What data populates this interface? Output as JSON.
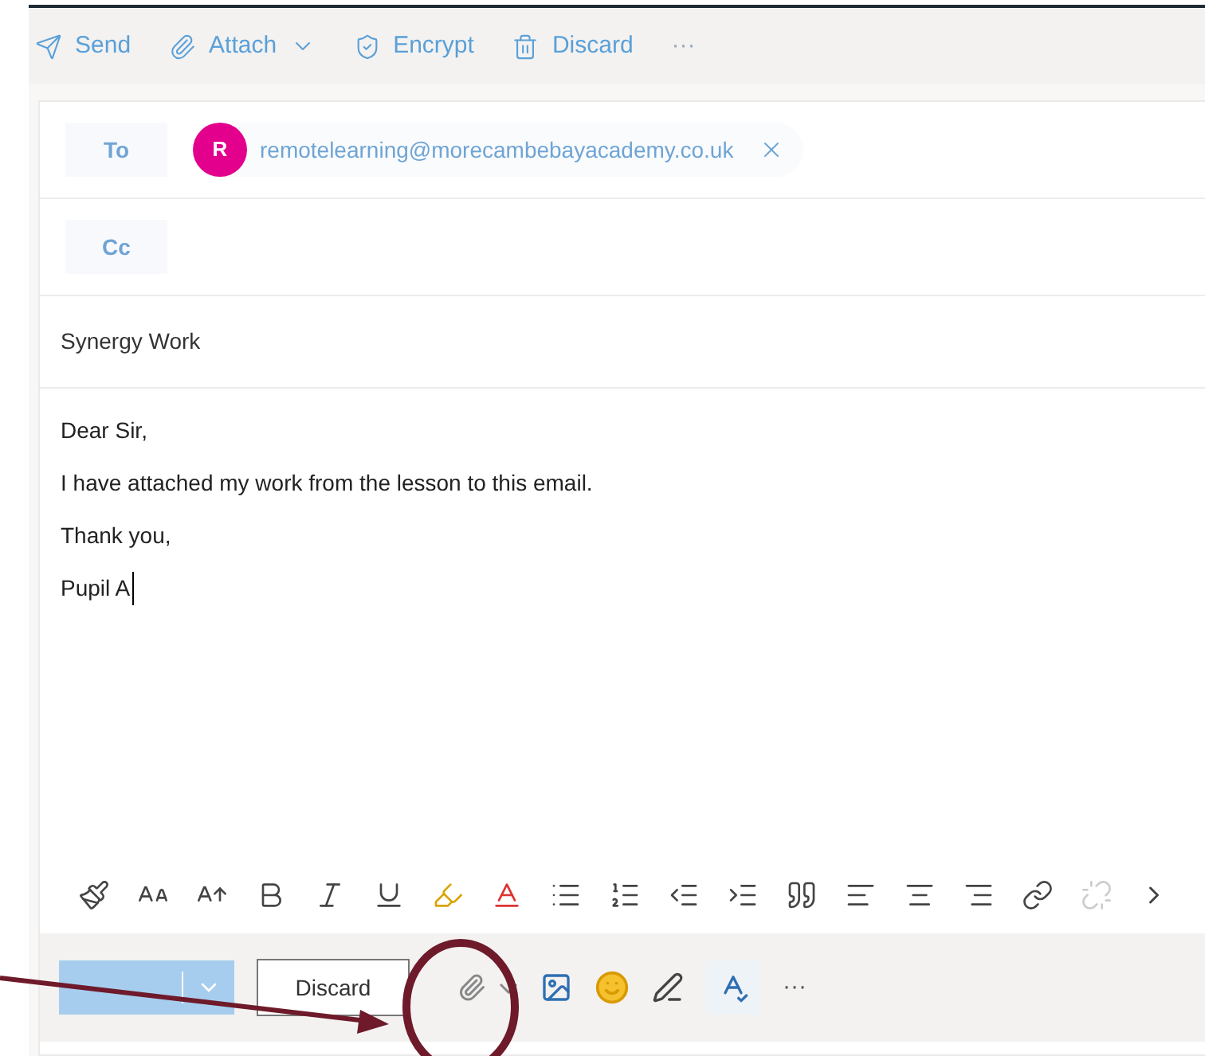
{
  "toolbar": {
    "actions": [
      {
        "kind": "send",
        "label": "Send"
      },
      {
        "kind": "attach",
        "label": "Attach"
      },
      {
        "kind": "encrypt",
        "label": "Encrypt"
      },
      {
        "kind": "discard",
        "label": "Discard"
      }
    ],
    "more": "···"
  },
  "to": {
    "label": "To",
    "recipients": [
      {
        "initial": "R",
        "email": "remotelearning@morecambebayacademy.co.uk",
        "color": "#e3008c"
      }
    ]
  },
  "cc": {
    "label": "Cc"
  },
  "subject": "Synergy Work",
  "body": [
    "Dear Sir,",
    "I have attached my work from the lesson to this email.",
    "Thank you,",
    "Pupil A"
  ],
  "format_toolbar": {
    "unlink_disabled": true
  },
  "footer": {
    "discard": "Discard",
    "more": "···"
  }
}
